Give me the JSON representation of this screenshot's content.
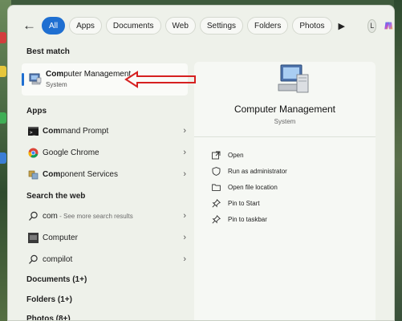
{
  "filters": {
    "all": "All",
    "apps": "Apps",
    "documents": "Documents",
    "web": "Web",
    "settings": "Settings",
    "folders": "Folders",
    "photos": "Photos",
    "more_icon": "play-icon"
  },
  "account": {
    "avatar_letter": "L"
  },
  "left": {
    "best_match_title": "Best match",
    "best_match": {
      "name_bold": "Com",
      "name_rest": "puter Management",
      "subtitle": "System"
    },
    "apps_title": "Apps",
    "apps": [
      {
        "bold": "Com",
        "rest": "mand Prompt",
        "icon": "cmd-icon"
      },
      {
        "bold": "",
        "rest": "Google Chrome",
        "icon": "chrome-icon"
      },
      {
        "bold": "Com",
        "rest": "ponent Services",
        "icon": "component-services-icon"
      }
    ],
    "web_title": "Search the web",
    "web": [
      {
        "label": "com",
        "hint": " - See more search results",
        "icon": "search-icon"
      },
      {
        "label": "Computer",
        "hint": "",
        "icon": "computer-icon"
      },
      {
        "label": "compilot",
        "hint": "",
        "icon": "search-icon"
      }
    ],
    "categories": [
      "Documents (1+)",
      "Folders (1+)",
      "Photos (8+)"
    ]
  },
  "right": {
    "title": "Computer Management",
    "subtitle": "System",
    "actions": [
      {
        "label": "Open",
        "icon": "open-icon"
      },
      {
        "label": "Run as administrator",
        "icon": "shield-icon"
      },
      {
        "label": "Open file location",
        "icon": "folder-icon"
      },
      {
        "label": "Pin to Start",
        "icon": "pin-icon"
      },
      {
        "label": "Pin to taskbar",
        "icon": "pin-icon"
      }
    ]
  },
  "colors": {
    "accent": "#1f6fd1",
    "annotation": "#d62020"
  }
}
